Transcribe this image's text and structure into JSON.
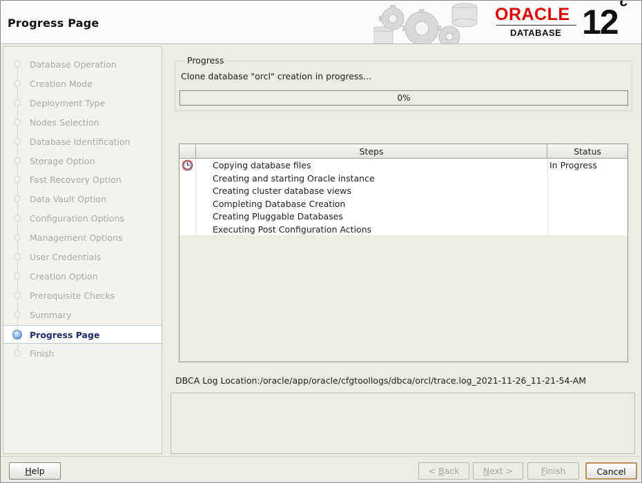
{
  "header": {
    "title": "Progress Page",
    "logo_brand": "ORACLE",
    "logo_product": "DATABASE",
    "logo_version": "12",
    "logo_version_suffix": "c"
  },
  "nav": {
    "items": [
      {
        "label": "Database Operation",
        "active": false
      },
      {
        "label": "Creation Mode",
        "active": false
      },
      {
        "label": "Deployment Type",
        "active": false
      },
      {
        "label": "Nodes Selection",
        "active": false
      },
      {
        "label": "Database Identification",
        "active": false
      },
      {
        "label": "Storage Option",
        "active": false
      },
      {
        "label": "Fast Recovery Option",
        "active": false
      },
      {
        "label": "Data Vault Option",
        "active": false
      },
      {
        "label": "Configuration Options",
        "active": false
      },
      {
        "label": "Management Options",
        "active": false
      },
      {
        "label": "User Credentials",
        "active": false
      },
      {
        "label": "Creation Option",
        "active": false
      },
      {
        "label": "Prerequisite Checks",
        "active": false
      },
      {
        "label": "Summary",
        "active": false
      },
      {
        "label": "Progress Page",
        "active": true
      },
      {
        "label": "Finish",
        "active": false
      }
    ]
  },
  "progress": {
    "group_title": "Progress",
    "status_text": "Clone database \"orcl\" creation in progress...",
    "percent_label": "0%",
    "fraction": 0
  },
  "steps_table": {
    "columns": [
      "Steps",
      "Status"
    ],
    "rows": [
      {
        "step": "Copying database files",
        "status": "In Progress",
        "icon": "clock-icon"
      },
      {
        "step": "Creating and starting Oracle instance",
        "status": ""
      },
      {
        "step": "Creating cluster database views",
        "status": ""
      },
      {
        "step": "Completing Database Creation",
        "status": ""
      },
      {
        "step": "Creating Pluggable Databases",
        "status": ""
      },
      {
        "step": "Executing Post Configuration Actions",
        "status": ""
      }
    ]
  },
  "log": {
    "location_text": "DBCA Log Location:/oracle/app/oracle/cfgtoollogs/dbca/orcl/trace.log_2021-11-26_11-21-54-AM"
  },
  "buttons": {
    "help": {
      "pre": "",
      "mnemonic": "H",
      "post": "elp"
    },
    "back": {
      "pre": "< ",
      "mnemonic": "B",
      "post": "ack"
    },
    "next": {
      "pre": "",
      "mnemonic": "N",
      "post": "ext >"
    },
    "finish": {
      "pre": "",
      "mnemonic": "F",
      "post": "inish"
    },
    "cancel": {
      "label": "Cancel"
    }
  },
  "colors": {
    "brand_red": "#e00000",
    "active_nav_text": "#1d2c6a",
    "progress_fill": "#7da3d6"
  }
}
